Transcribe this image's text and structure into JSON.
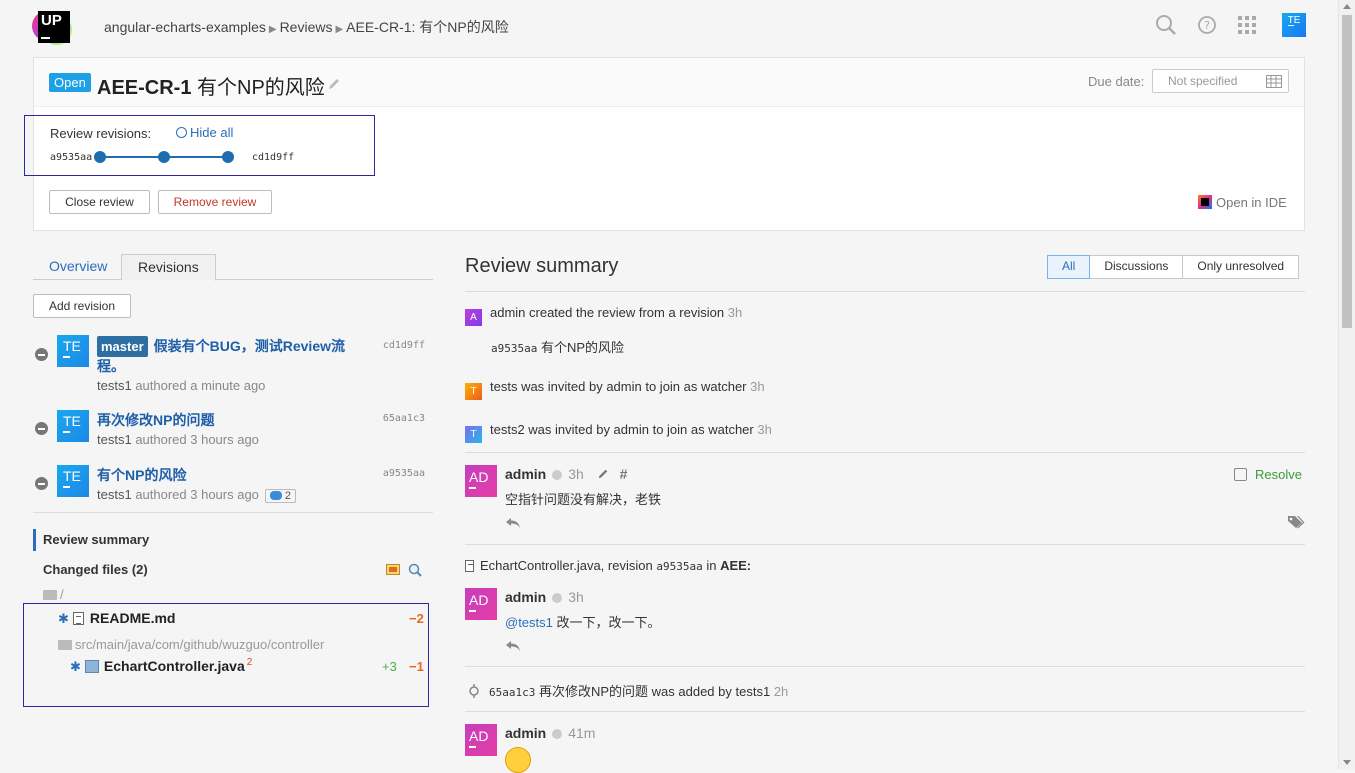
{
  "header": {
    "logo_text": "UP",
    "breadcrumb": [
      "angular-echarts-examples",
      "Reviews",
      "AEE-CR-1: 有个NP的风险"
    ],
    "user_avatar": "TE",
    "icons": [
      "search-icon",
      "help-icon",
      "apps-grid-icon"
    ]
  },
  "review": {
    "status": "Open",
    "id": "AEE-CR-1",
    "title": "有个NP的风险",
    "due_label": "Due date:",
    "due_value": "Not specified",
    "revisions_label": "Review revisions:",
    "hide_all": "Hide all",
    "rev_start": "a9535aa",
    "rev_end": "cd1d9ff",
    "close_button": "Close review",
    "remove_button": "Remove review",
    "open_ide": "Open in IDE"
  },
  "left": {
    "tabs": [
      "Overview",
      "Revisions"
    ],
    "active_tab": "Revisions",
    "add_revision": "Add revision",
    "revisions": [
      {
        "avatar": "TE",
        "branch": "master",
        "title_line1": "假装有个BUG，测试Review流",
        "title_line2": "程。",
        "author": "tests1",
        "authored": "authored a minute ago",
        "hash": "cd1d9ff"
      },
      {
        "avatar": "TE",
        "title_line1": "再次修改NP的问题",
        "author": "tests1",
        "authored": "authored 3 hours ago",
        "hash": "65aa1c3"
      },
      {
        "avatar": "TE",
        "title_line1": "有个NP的风险",
        "author": "tests1",
        "authored": "authored 3 hours ago",
        "hash": "a9535aa",
        "comments": "2"
      }
    ],
    "nav_summary": "Review summary",
    "nav_changed": "Changed files (2)",
    "root_dir": "/",
    "files": [
      {
        "name": "README.md",
        "removed": "−2"
      },
      {
        "dir": "src/main/java/com/github/wuzguo/controller"
      },
      {
        "name": "EchartController.java",
        "sup": "2",
        "added": "+3",
        "removed": "−1"
      }
    ]
  },
  "right": {
    "title": "Review summary",
    "filters": [
      "All",
      "Discussions",
      "Only unresolved"
    ],
    "events": [
      {
        "avatar": "A",
        "text": "admin created the review from a revision",
        "time": "3h"
      },
      {
        "hash": "a9535aa",
        "text": "有个NP的风险"
      },
      {
        "avatar": "T",
        "text": "tests was invited by admin to join as watcher",
        "time": "3h"
      },
      {
        "avatar": "T",
        "text": "tests2 was invited by admin to join as watcher",
        "time": "3h"
      }
    ],
    "comment1": {
      "avatar": "AD",
      "author": "admin",
      "time": "3h",
      "text": "空指针问题没有解决，老铁",
      "resolve": "Resolve"
    },
    "file_context": {
      "file": "EchartController.java, revision",
      "hash": "a9535aa",
      "in": "in",
      "project": "AEE:"
    },
    "comment2": {
      "avatar": "AD",
      "author": "admin",
      "time": "3h",
      "mention": "@tests1",
      "text": " 改一下，改一下。"
    },
    "revision_added": {
      "hash": "65aa1c3",
      "text": "再次修改NP的问题 was added by tests1",
      "time": "2h"
    },
    "comment3": {
      "avatar": "AD",
      "author": "admin",
      "time": "41m"
    }
  }
}
